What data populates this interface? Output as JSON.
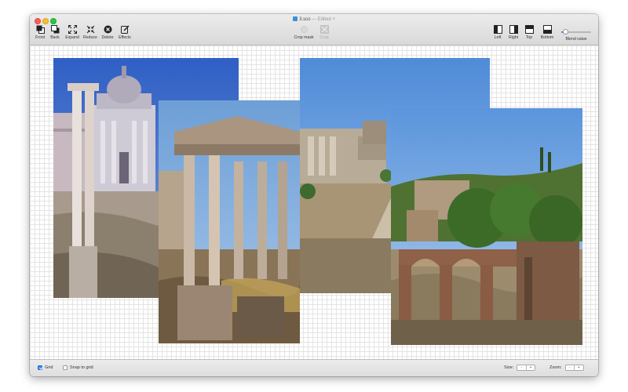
{
  "window": {
    "title": "3.sco",
    "edited": "— Edited ˅"
  },
  "toolbar": {
    "left_tools": [
      {
        "label": "Front",
        "icon": "bring-front-icon"
      },
      {
        "label": "Back",
        "icon": "send-back-icon"
      },
      {
        "label": "Expand",
        "icon": "expand-icon"
      },
      {
        "label": "Reduce",
        "icon": "reduce-icon"
      },
      {
        "label": "Delete",
        "icon": "delete-icon"
      },
      {
        "label": "Effects",
        "icon": "effects-icon"
      }
    ],
    "center_tools": [
      {
        "label": "Crop mask",
        "icon": "crop-mask-icon",
        "enabled": true
      },
      {
        "label": "Crop",
        "icon": "crop-icon",
        "enabled": false
      }
    ],
    "right_tools": [
      {
        "label": "Left",
        "icon": "align-left-icon"
      },
      {
        "label": "Right",
        "icon": "align-right-icon"
      },
      {
        "label": "Top",
        "icon": "align-top-icon"
      },
      {
        "label": "Bottom",
        "icon": "align-bottom-icon"
      }
    ],
    "blend_label": "Blend value",
    "blend_value": 0.15
  },
  "statusbar": {
    "grid_label": "Grid",
    "grid_checked": true,
    "snap_label": "Snap to grid",
    "snap_checked": false,
    "size_label": "Size:",
    "zoom_label": "Zoom:",
    "stepper_minus": "-",
    "stepper_plus": "+"
  },
  "colors": {
    "accent": "#3a86f0",
    "sky": "#5d97d6"
  }
}
